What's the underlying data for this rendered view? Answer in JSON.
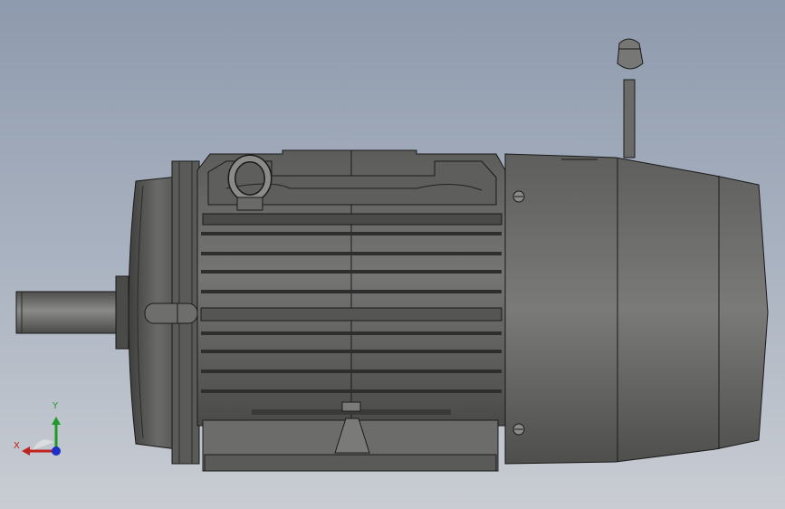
{
  "viewport": {
    "background_top": "#8e9aad",
    "background_bottom": "#c9cdd3"
  },
  "model": {
    "subject": "electric-motor-with-brake",
    "view": "side",
    "body_color": "#6a6a68",
    "body_dark": "#3a3a3a",
    "edge_color": "#1a1a1a"
  },
  "triad": {
    "x_label": "X",
    "y_label": "Y",
    "x_color": "#c0221d",
    "y_color": "#1f9a2a",
    "z_color": "#1d2fc4"
  }
}
